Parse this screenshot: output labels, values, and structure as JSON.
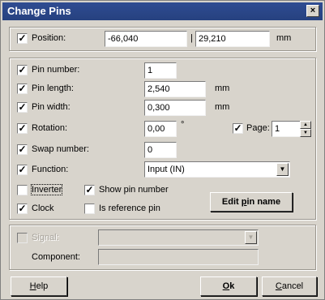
{
  "window": {
    "title": "Change Pins",
    "close": "×"
  },
  "position": {
    "label": "Position:",
    "x": "-66,040",
    "separator": "|",
    "y": "29,210",
    "unit": "mm",
    "checked": true
  },
  "pin_number": {
    "label": "Pin number:",
    "value": "1",
    "checked": true
  },
  "pin_length": {
    "label": "Pin length:",
    "value": "2,540",
    "unit": "mm",
    "checked": true
  },
  "pin_width": {
    "label": "Pin width:",
    "value": "0,300",
    "unit": "mm",
    "checked": true
  },
  "rotation": {
    "label": "Rotation:",
    "value": "0,00",
    "unit": "°",
    "checked": true
  },
  "page": {
    "label": "Page:",
    "value": "1",
    "checked": true
  },
  "swap_number": {
    "label": "Swap number:",
    "value": "0",
    "checked": true
  },
  "function": {
    "label": "Function:",
    "value": "Input (IN)",
    "checked": true
  },
  "inverter": {
    "label": "Inverter",
    "checked": false
  },
  "show_pin_number": {
    "label": "Show pin number",
    "checked": true
  },
  "clock": {
    "label": "Clock",
    "checked": true
  },
  "is_reference_pin": {
    "label": "Is reference pin",
    "checked": false
  },
  "edit_pin_name": {
    "label_pre": "Edit ",
    "label_u": "p",
    "label_post": "in name"
  },
  "signal": {
    "label": "Signal:",
    "value": "",
    "checked": false
  },
  "component": {
    "label": "Component:",
    "value": ""
  },
  "buttons": {
    "help": {
      "u": "H",
      "rest": "elp"
    },
    "ok": {
      "u": "O",
      "rest": "k"
    },
    "cancel": {
      "u": "C",
      "rest": "ancel"
    }
  }
}
